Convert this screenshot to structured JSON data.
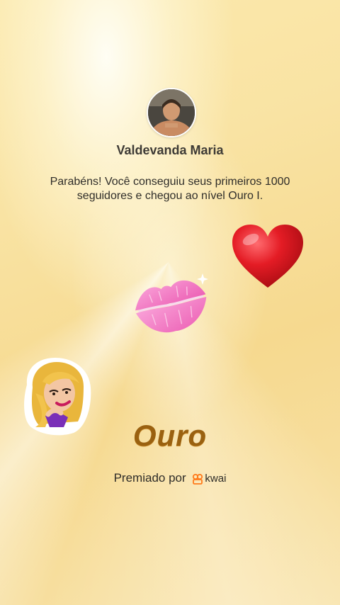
{
  "profile": {
    "name": "Valdevanda Maria",
    "message": "Parabéns! Você conseguiu seus primeiros 1000 seguidores e chegou ao nível Ouro I."
  },
  "level": {
    "title": "Ouro"
  },
  "award": {
    "prefix": "Premiado por",
    "brand": "kwai"
  },
  "icons": {
    "heart": "red-heart-icon",
    "kiss": "kiss-lips-icon",
    "sticker": "woman-sticker",
    "brand": "kwai-logo-icon"
  },
  "colors": {
    "level_text": "#9a6110",
    "brand_accent": "#ff7a1a",
    "heart": "#d4141e",
    "kiss": "#f27bc4"
  }
}
